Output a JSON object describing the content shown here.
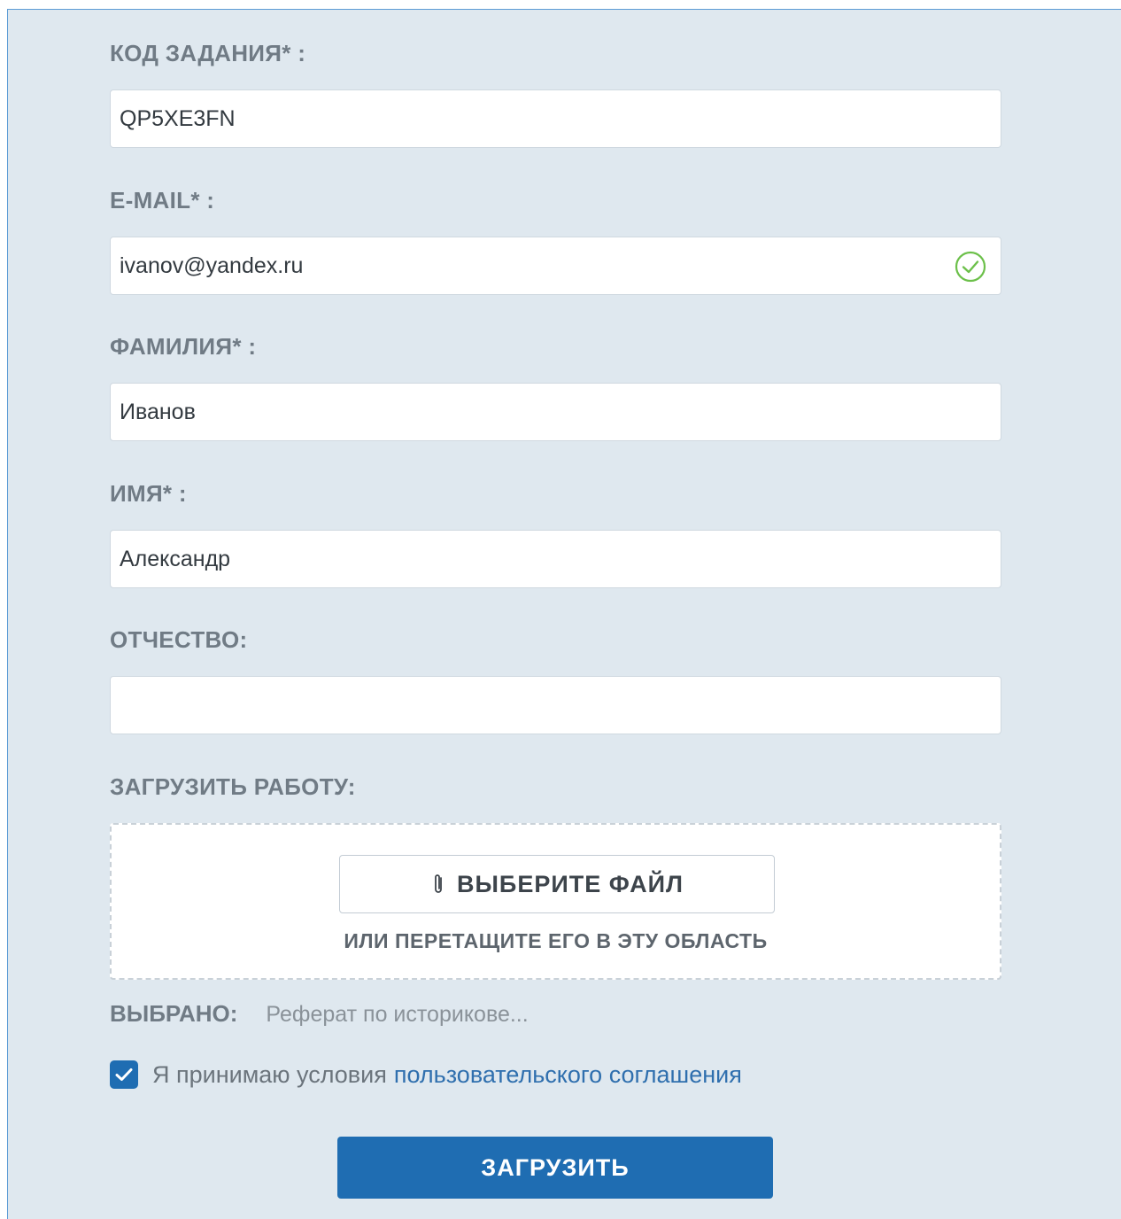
{
  "form": {
    "task_code": {
      "label": "КОД ЗАДАНИЯ* :",
      "value": "QP5XE3FN"
    },
    "email": {
      "label": "E-MAIL* :",
      "value": "ivanov@yandex.ru",
      "status_icon": "check-circle-icon"
    },
    "last_name": {
      "label": "ФАМИЛИЯ* :",
      "value": "Иванов"
    },
    "first_name": {
      "label": "ИМЯ* :",
      "value": "Александр"
    },
    "middle_name": {
      "label": "ОТЧЕСТВО:",
      "value": ""
    },
    "upload": {
      "label": "ЗАГРУЗИТЬ РАБОТУ:",
      "choose_file": "ВЫБЕРИТЕ ФАЙЛ",
      "choose_icon": "paperclip-icon",
      "drop_hint": "ИЛИ ПЕРЕТАЩИТЕ ЕГО В ЭТУ ОБЛАСТЬ"
    },
    "selected": {
      "label": "ВЫБРАНО:",
      "value": "Реферат по историкове..."
    },
    "agreement": {
      "checked": true,
      "text": "Я принимаю условия",
      "link_text": "пользовательского соглашения"
    },
    "submit_label": "ЗАГРУЗИТЬ"
  },
  "colors": {
    "background": "#dfe8ef",
    "accent": "#1f6db2",
    "link": "#2f6fae",
    "valid": "#6cc04a"
  }
}
